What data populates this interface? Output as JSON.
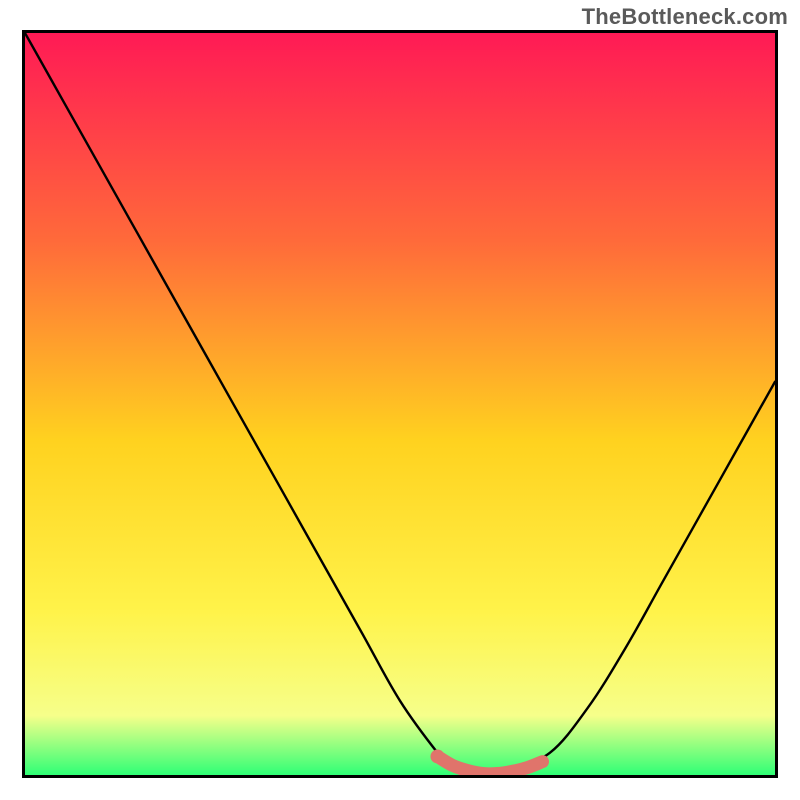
{
  "watermark": "TheBottleneck.com",
  "colors": {
    "gradient_top": "#ff1a55",
    "gradient_mid_upper": "#ff6a3a",
    "gradient_mid": "#ffd21f",
    "gradient_mid_lower": "#fff34a",
    "gradient_lower": "#f6ff8a",
    "gradient_bottom": "#2fff76",
    "curve": "#000000",
    "marker": "#e0746b",
    "border": "#000000"
  },
  "chart_data": {
    "type": "line",
    "title": "",
    "xlabel": "",
    "ylabel": "",
    "xlim": [
      0,
      100
    ],
    "ylim": [
      0,
      100
    ],
    "grid": false,
    "series": [
      {
        "name": "bottleneck-curve",
        "x": [
          0,
          5,
          10,
          15,
          20,
          25,
          30,
          35,
          40,
          45,
          50,
          55,
          57,
          60,
          63,
          65,
          70,
          75,
          80,
          85,
          90,
          95,
          100
        ],
        "y": [
          100,
          91,
          82,
          73,
          64,
          55,
          46,
          37,
          28,
          19,
          10,
          3,
          1,
          0,
          0,
          1,
          3,
          9,
          17,
          26,
          35,
          44,
          53
        ]
      }
    ],
    "markers": [
      {
        "name": "highlight-band",
        "x": [
          55,
          57,
          59,
          61,
          63,
          65,
          67,
          69
        ],
        "y": [
          2.5,
          1.3,
          0.6,
          0.2,
          0.2,
          0.5,
          1.0,
          1.8
        ]
      }
    ]
  }
}
